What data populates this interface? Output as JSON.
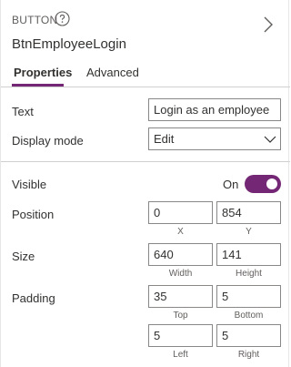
{
  "header": {
    "control_type": "BUTTON",
    "control_name": "BtnEmployeeLogin"
  },
  "tabs": [
    {
      "label": "Properties",
      "active": true
    },
    {
      "label": "Advanced",
      "active": false
    }
  ],
  "properties": {
    "text": {
      "label": "Text",
      "value": "Login as an employee"
    },
    "display_mode": {
      "label": "Display mode",
      "value": "Edit"
    },
    "visible": {
      "label": "Visible",
      "state_label": "On",
      "on": true
    },
    "position": {
      "label": "Position",
      "x": "0",
      "y": "854",
      "x_caption": "X",
      "y_caption": "Y"
    },
    "size": {
      "label": "Size",
      "width": "640",
      "height": "141",
      "width_caption": "Width",
      "height_caption": "Height"
    },
    "padding": {
      "label": "Padding",
      "top": "35",
      "bottom": "5",
      "left": "5",
      "right": "5",
      "top_caption": "Top",
      "bottom_caption": "Bottom",
      "left_caption": "Left",
      "right_caption": "Right"
    }
  },
  "colors": {
    "accent": "#742774",
    "border": "#8a8886",
    "divider": "#d0d0d0"
  },
  "icons": [
    "help-icon",
    "chevron-right-icon",
    "chevron-down-icon"
  ]
}
